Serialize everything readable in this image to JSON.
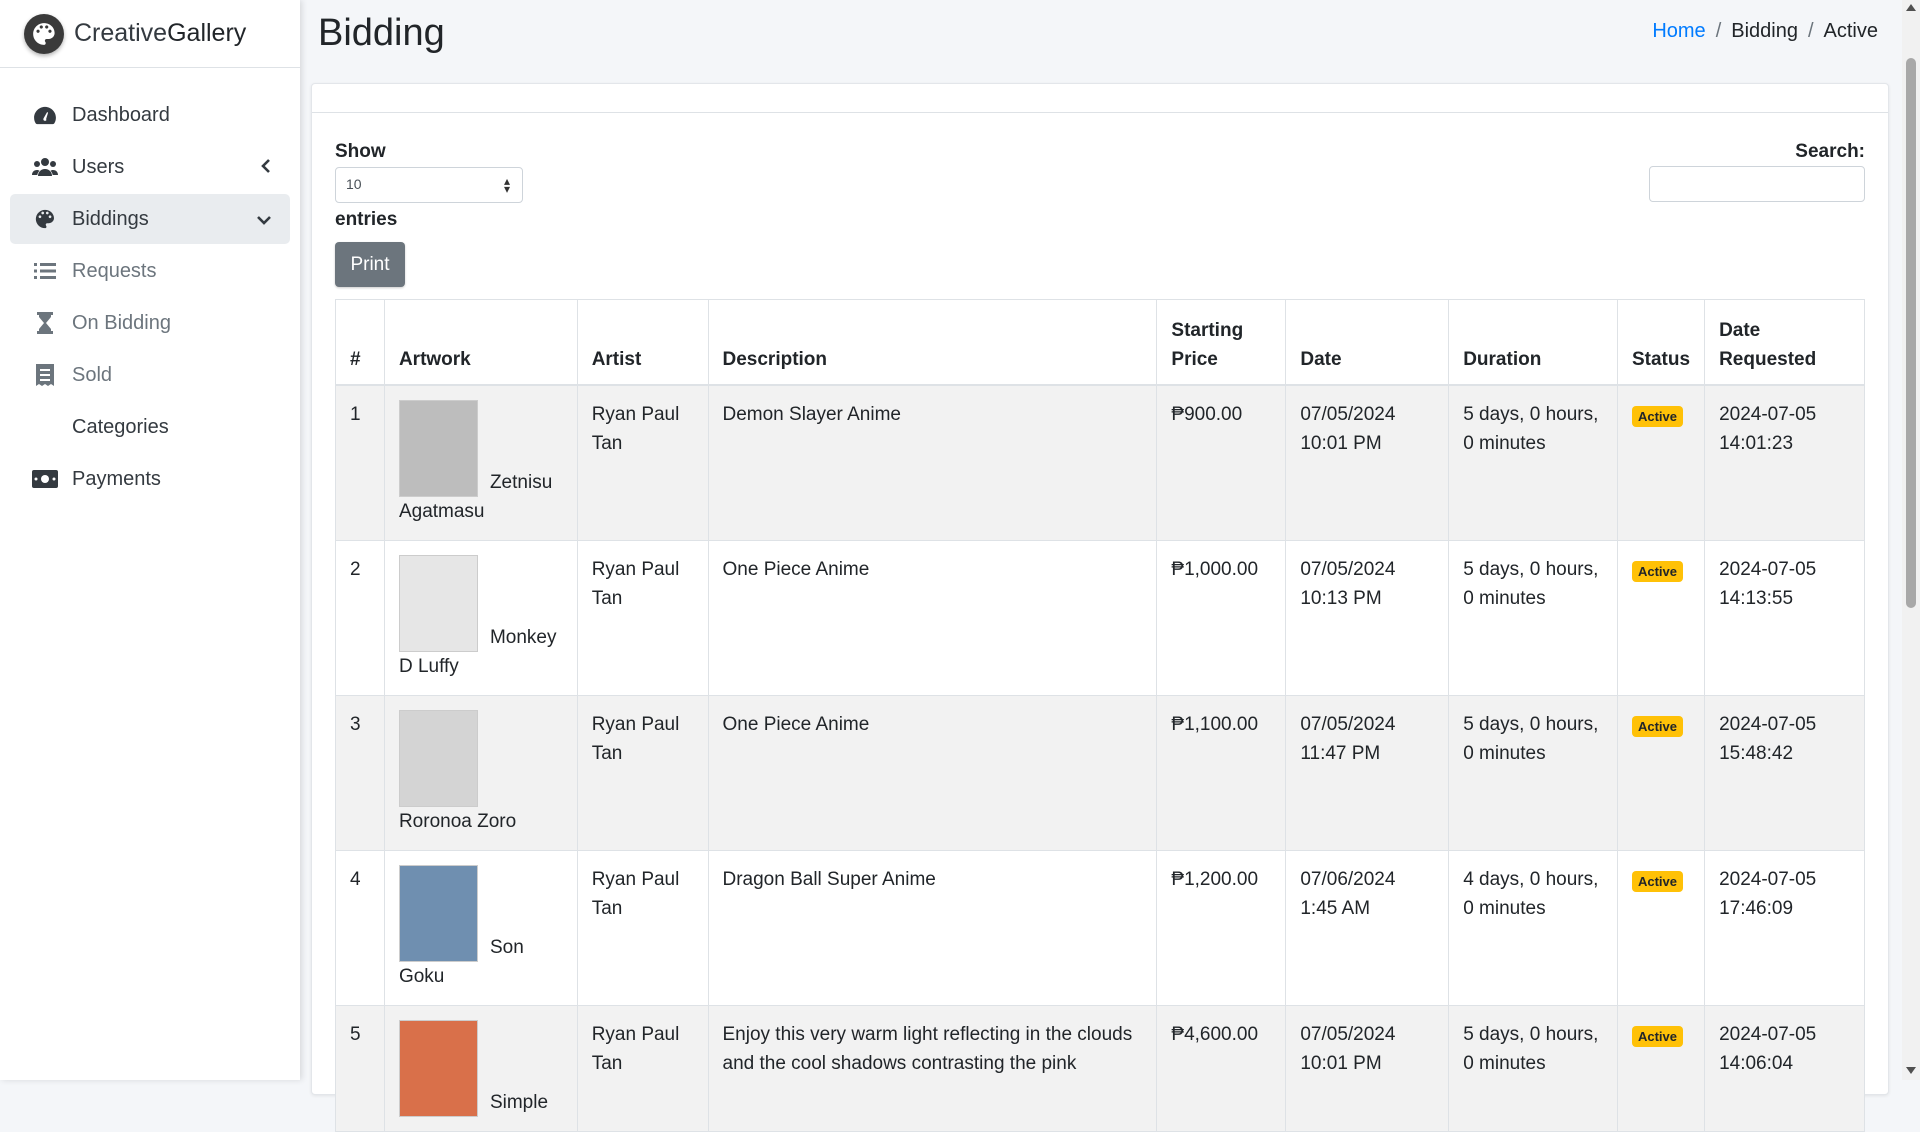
{
  "brand": {
    "pre": "Creative",
    "bold": "Gallery",
    "logo_icon": "palette-logo"
  },
  "sidebar": {
    "items": [
      {
        "label": "Dashboard",
        "icon": "gauge-icon"
      },
      {
        "label": "Users",
        "icon": "users-icon"
      },
      {
        "label": "Biddings",
        "icon": "palette-icon"
      },
      {
        "label": "Requests",
        "icon": "list-icon"
      },
      {
        "label": "On Bidding",
        "icon": "hourglass-icon"
      },
      {
        "label": "Sold",
        "icon": "receipt-icon"
      },
      {
        "label": "Categories",
        "icon": ""
      },
      {
        "label": "Payments",
        "icon": "money-icon"
      }
    ]
  },
  "header": {
    "title": "Bidding"
  },
  "breadcrumb": {
    "home": "Home",
    "section": "Bidding",
    "current": "Active",
    "sep": "/"
  },
  "controls": {
    "show_label": "Show",
    "entries_value": "10",
    "entries_label": "entries",
    "search_label": "Search:",
    "print_label": "Print"
  },
  "table": {
    "headers": {
      "num": "#",
      "artwork": "Artwork",
      "artist": "Artist",
      "description": "Description",
      "starting_price": "Starting Price",
      "date": "Date",
      "duration": "Duration",
      "status": "Status",
      "date_requested": "Date Requested"
    },
    "rows": [
      {
        "num": "1",
        "artwork": "Zetnisu Agatmasu",
        "artist": "Ryan Paul Tan",
        "description": "Demon Slayer Anime",
        "price": "₱900.00",
        "date": "07/05/2024 10:01 PM",
        "duration": "5 days, 0 hours, 0 minutes",
        "status": "Active",
        "requested": "2024-07-05 14:01:23",
        "thumb_color": "#bdbdbd"
      },
      {
        "num": "2",
        "artwork": "Monkey D Luffy",
        "artist": "Ryan Paul Tan",
        "description": "One Piece Anime",
        "price": "₱1,000.00",
        "date": "07/05/2024 10:13 PM",
        "duration": "5 days, 0 hours, 0 minutes",
        "status": "Active",
        "requested": "2024-07-05 14:13:55",
        "thumb_color": "#e6e6e6"
      },
      {
        "num": "3",
        "artwork": "Roronoa Zoro",
        "artist": "Ryan Paul Tan",
        "description": "One Piece Anime",
        "price": "₱1,100.00",
        "date": "07/05/2024 11:47 PM",
        "duration": "5 days, 0 hours, 0 minutes",
        "status": "Active",
        "requested": "2024-07-05 15:48:42",
        "thumb_color": "#d4d4d4"
      },
      {
        "num": "4",
        "artwork": "Son Goku",
        "artist": "Ryan Paul Tan",
        "description": "Dragon Ball Super Anime",
        "price": "₱1,200.00",
        "date": "07/06/2024 1:45 AM",
        "duration": "4 days, 0 hours, 0 minutes",
        "status": "Active",
        "requested": "2024-07-05 17:46:09",
        "thumb_color": "#6f8fb0"
      },
      {
        "num": "5",
        "artwork": "Simple",
        "artist": "Ryan Paul Tan",
        "description": "Enjoy this very warm light reflecting in the clouds and the cool shadows contrasting the pink",
        "price": "₱4,600.00",
        "date": "07/05/2024 10:01 PM",
        "duration": "5 days, 0 hours, 0 minutes",
        "status": "Active",
        "requested": "2024-07-05 14:06:04",
        "thumb_color": "#d9704a"
      }
    ]
  },
  "colors": {
    "link": "#007bff",
    "badge": "#ffc107",
    "print_button": "#6c757d"
  }
}
